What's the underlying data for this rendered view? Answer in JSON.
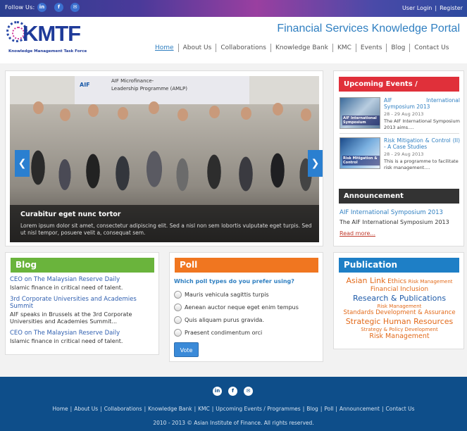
{
  "topbar": {
    "follow_label": "Follow Us:",
    "social_icons": [
      "linkedin-icon",
      "facebook-icon",
      "email-icon"
    ],
    "user_login": "User Login",
    "separator": "|",
    "register": "Register"
  },
  "header": {
    "logo_text": "KMTF",
    "logo_subtitle": "Knowledge Management Task Force",
    "portal_title": "Financial Services Knowledge Portal",
    "nav": [
      "Home",
      "About Us",
      "Collaborations",
      "Knowledge Bank",
      "KMC",
      "Events",
      "Blog",
      "Contact Us"
    ],
    "active_nav": "Home"
  },
  "slider": {
    "banner_org": "AIF",
    "banner_line1": "AIF Microfinance-",
    "banner_line2": "Leadership Programme (AMLP)",
    "caption_title": "Curabitur eget nunc tortor",
    "caption_text": "Lorem ipsum dolor sit amet, consectetur adipiscing elit. Sed a nisl non sem lobortis vulputate eget turpis. Sed ut nisl tempor, posuere velit a, consequat sem.",
    "prev_label": "❮",
    "next_label": "❯"
  },
  "events": {
    "title": "Upcoming Events / Programmes",
    "items": [
      {
        "title": "AIF International Symposium 2013",
        "date": "28 - 29 Aug 2013",
        "excerpt": "The AIF International Symposium 2013 aims....",
        "thumb_label": "AIF International Symposium"
      },
      {
        "title": "Risk Mitigation & Control (II) - A Case Studies",
        "date": "28 - 29 Aug 2013",
        "excerpt": "This is a programme to facilitate risk management....",
        "thumb_label": "Risk Mitigation & Control"
      }
    ]
  },
  "announcement": {
    "title": "Announcement",
    "link": "AIF International Symposium 2013",
    "text": "The AIF International Symposium 2013",
    "read_more": "Read more..."
  },
  "blog": {
    "title": "Blog",
    "items": [
      {
        "title": "CEO on The Malaysian Reserve Daily",
        "desc": "Islamic finance in critical need of talent."
      },
      {
        "title": "3rd Corporate Universities and Academies Summit",
        "desc": "AIF speaks in Brussels at the 3rd Corporate Universities and Academies Summit..."
      },
      {
        "title": "CEO on The Malaysian Reserve Daily",
        "desc": "Islamic finance in critical need of talent."
      }
    ]
  },
  "poll": {
    "title": "Poll",
    "question": "Which poll types do you prefer using?",
    "options": [
      "Mauris vehicula sagittis turpis",
      "Aenean auctor neque eget enim tempus",
      "Quis aliquam purus gravida.",
      "Praesent condimentum orci"
    ],
    "vote_label": "Vote"
  },
  "publication": {
    "title": "Publication",
    "tags": [
      "Asian Link",
      "Ethics",
      "Risk Management",
      "Financial Inclusion",
      "Research & Publications",
      "Risk Management",
      "Standards Development & Assurance",
      "Strategic Human Resources",
      "Strategy & Policy Development",
      "Risk Management"
    ]
  },
  "footer": {
    "icons": [
      "linkedin-icon",
      "facebook-icon",
      "email-icon"
    ],
    "links": [
      "Home",
      "About Us",
      "Collaborations",
      "Knowledge Bank",
      "KMC",
      "Upcoming Events / Programmes",
      "Blog",
      "Poll",
      "Announcement",
      "Contact Us"
    ],
    "copyright": "2010 - 2013 © Asian Institute of Finance. All rights reserved."
  },
  "colors": {
    "brand_blue": "#1e3a99",
    "link_blue": "#2f7fc1",
    "events_red": "#e0303a",
    "blog_green": "#6ab43c",
    "poll_orange": "#f07620",
    "footer_blue": "#0e4e8a"
  }
}
